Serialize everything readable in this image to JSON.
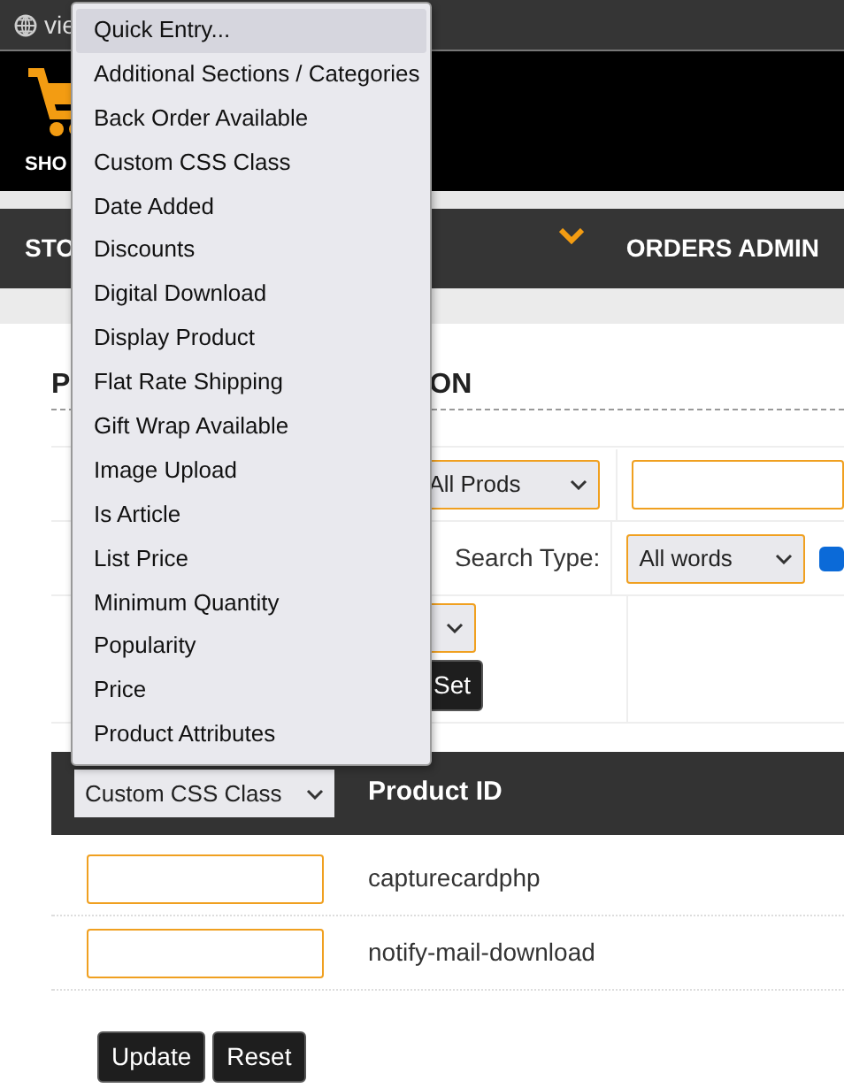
{
  "browser_tab": {
    "title": "vie"
  },
  "header": {
    "logo_text": "SHO"
  },
  "nav": {
    "items": [
      {
        "label": "STO"
      },
      {
        "label": "ORDERS ADMIN"
      }
    ]
  },
  "page_heading": {
    "parts": [
      "P",
      "ON"
    ]
  },
  "search_form": {
    "scope_select": {
      "value": "All Prods"
    },
    "search_type": {
      "label": "Search Type:",
      "value": "All words"
    },
    "option_checkbox": {
      "checked": true
    },
    "set_button": "Set"
  },
  "table": {
    "field_select": {
      "value": "Custom CSS Class"
    },
    "columns": [
      "Product ID"
    ],
    "rows": [
      {
        "product_id": "capturecardphp"
      },
      {
        "product_id": "notify-mail-download"
      }
    ]
  },
  "buttons": [
    "Update",
    "Reset"
  ],
  "dropdown": {
    "options": [
      {
        "label": "Quick Entry...",
        "selected": true
      },
      {
        "label": "Additional Sections / Categories",
        "selected": false
      },
      {
        "label": "Back Order Available",
        "selected": false
      },
      {
        "label": "Custom CSS Class",
        "selected": false
      },
      {
        "label": "Date Added",
        "selected": false
      },
      {
        "label": "Discounts",
        "selected": false
      },
      {
        "label": "Digital Download",
        "selected": false
      },
      {
        "label": "Display Product",
        "selected": false
      },
      {
        "label": "Flat Rate Shipping",
        "selected": false
      },
      {
        "label": "Gift Wrap Available",
        "selected": false
      },
      {
        "label": "Image Upload",
        "selected": false
      },
      {
        "label": "Is Article",
        "selected": false
      },
      {
        "label": "List Price",
        "selected": false
      },
      {
        "label": "Minimum Quantity",
        "selected": false
      },
      {
        "label": "Popularity",
        "selected": false
      },
      {
        "label": "Price",
        "selected": false
      },
      {
        "label": "Product Attributes",
        "selected": false
      }
    ]
  }
}
